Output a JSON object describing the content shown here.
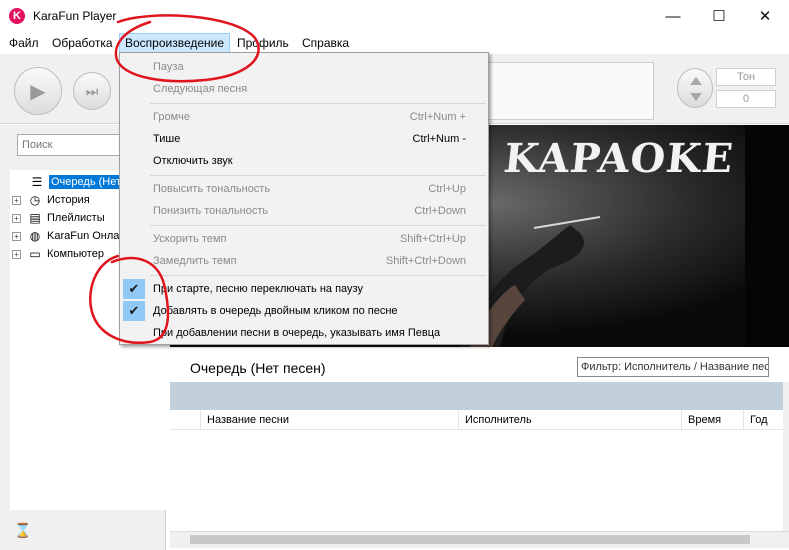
{
  "window": {
    "title": "KaraFun Player",
    "logo_letter": "K",
    "minimize_glyph": "—",
    "maximize_glyph": "☐",
    "close_glyph": "✕"
  },
  "menubar": {
    "items": [
      {
        "label": "Файл"
      },
      {
        "label": "Обработка"
      },
      {
        "label": "Воспроизведение"
      },
      {
        "label": "Профиль"
      },
      {
        "label": "Справка"
      }
    ]
  },
  "toolbar": {
    "tone_label": "Тон",
    "tone_value": "0",
    "play_icon": "▶",
    "next_icon": "⏭"
  },
  "sidebar": {
    "search_placeholder": "Поиск",
    "items": [
      {
        "label": "Очередь (Нет",
        "icon": "queue-icon",
        "glyph": "☰"
      },
      {
        "label": "История",
        "icon": "history-clock-icon",
        "glyph": "◷"
      },
      {
        "label": "Плейлисты",
        "icon": "playlist-icon",
        "glyph": "▤"
      },
      {
        "label": "KaraFun Онла",
        "icon": "globe-icon",
        "glyph": "◍"
      },
      {
        "label": "Компьютер",
        "icon": "computer-icon",
        "glyph": "▭"
      }
    ],
    "expander_glyph": "+",
    "hourglass_glyph": "⌛"
  },
  "video": {
    "title_text": "KAPAOKE"
  },
  "queue": {
    "title": "Очередь (Нет песен)",
    "filter_value": "Фильтр: Исполнитель / Название пес",
    "columns": [
      "Название песни",
      "Исполнитель",
      "Время",
      "Год"
    ]
  },
  "dropdown": {
    "check_glyph": "✔",
    "items": [
      {
        "label": "Пауза",
        "shortcut": "",
        "disabled": true,
        "checked": false
      },
      {
        "label": "Следующая песня",
        "shortcut": "",
        "disabled": true,
        "checked": false
      },
      {
        "label": "Громче",
        "shortcut": "Ctrl+Num +",
        "disabled": true,
        "checked": false
      },
      {
        "label": "Тише",
        "shortcut": "Ctrl+Num -",
        "disabled": false,
        "checked": false
      },
      {
        "label": "Отключить звук",
        "shortcut": "",
        "disabled": false,
        "checked": false
      },
      {
        "label": "Повысить тональность",
        "shortcut": "Ctrl+Up",
        "disabled": true,
        "checked": false
      },
      {
        "label": "Понизить тональность",
        "shortcut": "Ctrl+Down",
        "disabled": true,
        "checked": false
      },
      {
        "label": "Ускорить темп",
        "shortcut": "Shift+Ctrl+Up",
        "disabled": true,
        "checked": false
      },
      {
        "label": "Замедлить темп",
        "shortcut": "Shift+Ctrl+Down",
        "disabled": true,
        "checked": false
      },
      {
        "label": "При старте, песню переключать на паузу",
        "shortcut": "",
        "disabled": false,
        "checked": true
      },
      {
        "label": "Добавлять в очередь двойным кликом по песне",
        "shortcut": "",
        "disabled": false,
        "checked": true
      },
      {
        "label": "При добавлении песни в очередь, указывать имя Певца",
        "shortcut": "",
        "disabled": false,
        "checked": false
      }
    ]
  },
  "colors": {
    "accent": "#0078d7",
    "menu_highlight": "#cce8ff",
    "annotation": "#e0141e",
    "logo": "#e0115f"
  }
}
